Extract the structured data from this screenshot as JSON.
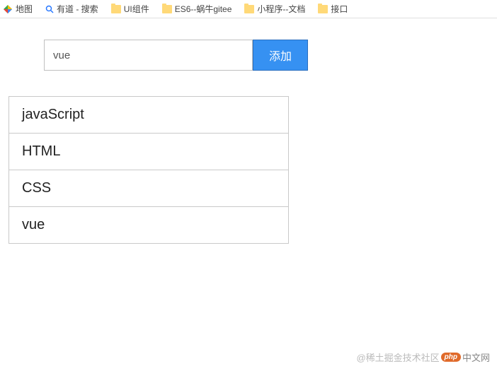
{
  "bookmarks": [
    {
      "label": "地图",
      "icon": "maps"
    },
    {
      "label": "有道 - 搜索",
      "icon": "search"
    },
    {
      "label": "UI组件",
      "icon": "folder"
    },
    {
      "label": "ES6--蜗牛gitee",
      "icon": "folder"
    },
    {
      "label": "小程序--文档",
      "icon": "folder"
    },
    {
      "label": "接口",
      "icon": "folder"
    }
  ],
  "form": {
    "input_value": "vue",
    "add_button_label": "添加"
  },
  "list_items": [
    "javaScript",
    "HTML",
    "CSS",
    "vue"
  ],
  "watermark": {
    "community": "@稀土掘金技术社区",
    "badge": "php",
    "site": "中文网"
  }
}
